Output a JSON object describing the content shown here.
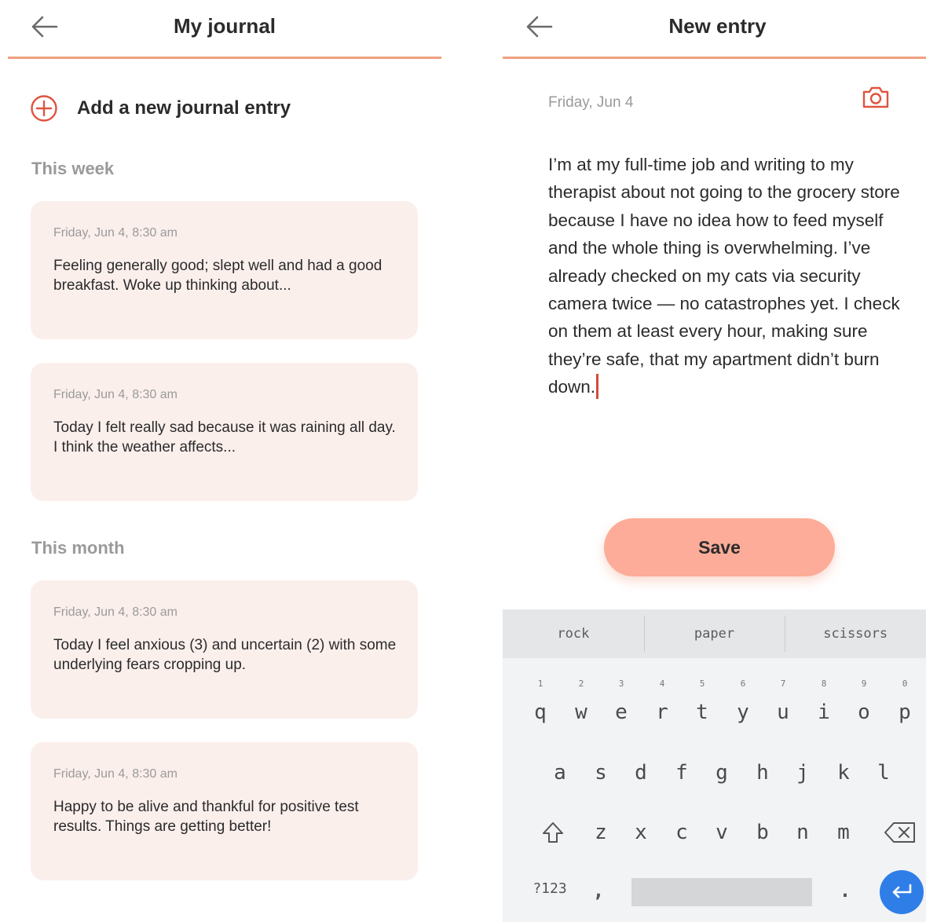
{
  "journal": {
    "title": "My journal",
    "add_entry_label": "Add a new journal entry",
    "sections": [
      {
        "heading": "This week",
        "entries": [
          {
            "date": "Friday, Jun 4, 8:30 am",
            "text": "Feeling generally good; slept well and had a good breakfast. Woke up thinking about..."
          },
          {
            "date": "Friday, Jun 4, 8:30 am",
            "text": "Today I felt really sad because it was raining all day. I think the weather affects..."
          }
        ]
      },
      {
        "heading": "This month",
        "entries": [
          {
            "date": "Friday, Jun 4, 8:30 am",
            "text": "Today I feel anxious (3) and uncertain (2) with some underlying fears cropping up."
          },
          {
            "date": "Friday, Jun 4, 8:30 am",
            "text": "Happy to be alive and thankful for positive test results. Things are getting better!"
          }
        ]
      }
    ]
  },
  "new_entry": {
    "title": "New entry",
    "date": "Friday, Jun 4",
    "text": "I’m at my full-time job and writing to my therapist about not going to the grocery store because I have no idea how to feed myself and the whole thing is overwhelming. I’ve already checked on my cats via security camera twice — no catastrophes yet. I check on them at least every hour, making sure they’re safe, that my apartment didn’t burn down.",
    "save_label": "Save"
  },
  "keyboard": {
    "suggestions": [
      "rock",
      "paper",
      "scissors"
    ],
    "row1": [
      {
        "hint": "1",
        "key": "q"
      },
      {
        "hint": "2",
        "key": "w"
      },
      {
        "hint": "3",
        "key": "e"
      },
      {
        "hint": "4",
        "key": "r"
      },
      {
        "hint": "5",
        "key": "t"
      },
      {
        "hint": "6",
        "key": "y"
      },
      {
        "hint": "7",
        "key": "u"
      },
      {
        "hint": "8",
        "key": "i"
      },
      {
        "hint": "9",
        "key": "o"
      },
      {
        "hint": "0",
        "key": "p"
      }
    ],
    "row2": [
      "a",
      "s",
      "d",
      "f",
      "g",
      "h",
      "j",
      "k",
      "l"
    ],
    "row3": [
      "z",
      "x",
      "c",
      "v",
      "b",
      "n",
      "m"
    ],
    "symbols_label": "?123",
    "comma": ",",
    "period": "."
  },
  "colors": {
    "accent_line": "#f0a080",
    "card_bg": "#fbefec",
    "save_button": "#fcac98",
    "enter_key": "#2f7ee8",
    "caret": "#d24b3a"
  },
  "icons": [
    "back-arrow-icon",
    "plus-circle-icon",
    "camera-icon",
    "shift-icon",
    "backspace-icon",
    "enter-icon"
  ]
}
